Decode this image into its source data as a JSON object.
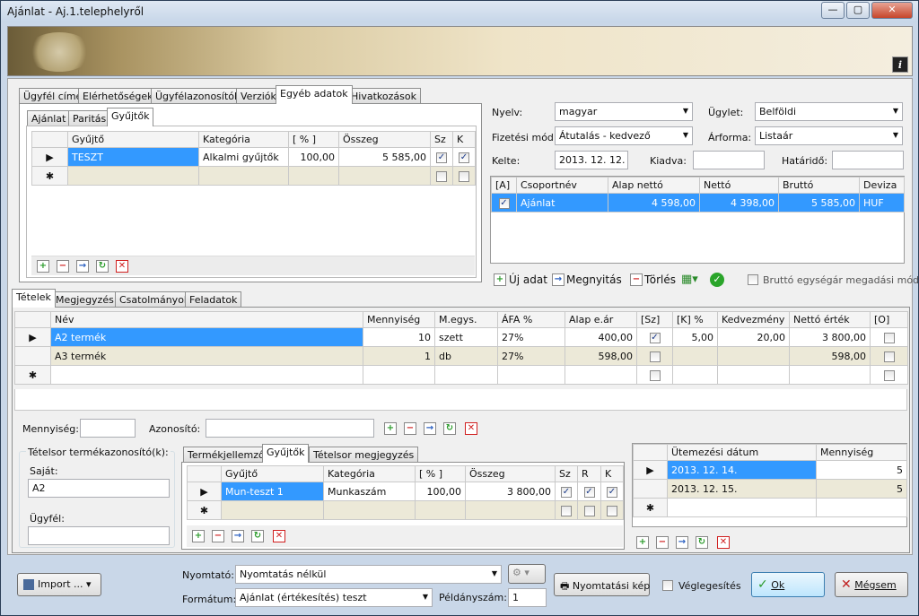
{
  "window": {
    "title": "Ajánlat - Aj.1.telephelyről",
    "min": "—",
    "max": "▢",
    "close": "✕"
  },
  "top_tabs": [
    "Ügyfél címe",
    "Elérhetőségek",
    "Ügyfélazonosítók",
    "Verziók",
    "Egyéb adatok",
    "Hivatkozások"
  ],
  "sub_tabs": [
    "Ajánlat",
    "Paritás",
    "Gyűjtők"
  ],
  "gy_grid": {
    "headers": [
      "Gyűjtő",
      "Kategória",
      "[ % ]",
      "Összeg",
      "Sz",
      "K"
    ],
    "rows": [
      {
        "gyujto": "TESZT",
        "kategoria": "Alkalmi gyűjtők",
        "pct": "100,00",
        "osszeg": "5 585,00"
      }
    ]
  },
  "form": {
    "nyelv_label": "Nyelv:",
    "nyelv": "magyar",
    "ugylet_label": "Ügylet:",
    "ugylet": "Belföldi",
    "fizmod_label": "Fizetési mód:",
    "fizmod": "Átutalás - kedvező",
    "arforma_label": "Árforma:",
    "arforma": "Listaár",
    "kelte_label": "Kelte:",
    "kelte": "2013. 12. 12.",
    "kiadva_label": "Kiadva:",
    "hatarido_label": "Határidő:"
  },
  "group_grid": {
    "headers": [
      "[A]",
      "Csoportnév",
      "Alap nettó",
      "Nettó",
      "Bruttó",
      "Deviza"
    ],
    "rows": [
      {
        "nev": "Ajánlat",
        "alap": "4 598,00",
        "netto": "4 398,00",
        "brutto": "5 585,00",
        "deviza": "HUF"
      }
    ]
  },
  "actions": {
    "uj": "Új adat",
    "megnyitas": "Megnyitás",
    "torles": "Törlés",
    "brutto_mod": "Bruttó egységár megadási mód"
  },
  "item_tabs": [
    "Tételek",
    "Megjegyzés",
    "Csatolmányok",
    "Feladatok"
  ],
  "items": {
    "headers": [
      "Név",
      "Mennyiség",
      "M.egys.",
      "ÁFA %",
      "Alap e.ár",
      "[Sz]",
      "[K] %",
      "Kedvezmény",
      "Nettó érték",
      "[O]"
    ],
    "rows": [
      {
        "nev": "A2 termék",
        "menny": "10",
        "megys": "szett",
        "afa": "27%",
        "alap": "400,00",
        "k": "5,00",
        "kedv": "20,00",
        "netto": "3 800,00"
      },
      {
        "nev": "A3 termék",
        "menny": "1",
        "megys": "db",
        "afa": "27%",
        "alap": "598,00",
        "k": "",
        "kedv": "",
        "netto": "598,00"
      }
    ]
  },
  "filter": {
    "menny_label": "Mennyiség:",
    "azon_label": "Azonosító:"
  },
  "tetelsor": {
    "title": "Tételsor termékazonosító(k):",
    "sajat_label": "Saját:",
    "sajat": "A2",
    "ugyfel_label": "Ügyfél:"
  },
  "lower_tabs": [
    "Termékjellemzők",
    "Gyűjtők",
    "Tételsor megjegyzés"
  ],
  "lower_grid": {
    "headers": [
      "Gyűjtő",
      "Kategória",
      "[ % ]",
      "Összeg",
      "Sz",
      "R",
      "K"
    ],
    "rows": [
      {
        "gyujto": "Mun-teszt 1",
        "kategoria": "Munkaszám",
        "pct": "100,00",
        "osszeg": "3 800,00"
      }
    ]
  },
  "schedule": {
    "headers": [
      "Ütemezési dátum",
      "Mennyiség"
    ],
    "rows": [
      {
        "datum": "2013. 12. 14.",
        "menny": "5"
      },
      {
        "datum": "2013. 12. 15.",
        "menny": "5"
      }
    ]
  },
  "footer": {
    "import": "Import ...",
    "nyomtato_label": "Nyomtató:",
    "nyomtato": "Nyomtatás nélkül",
    "formatum_label": "Formátum:",
    "formatum": "Ajánlat (értékesítés) teszt",
    "peldany_label": "Példányszám:",
    "peldany": "1",
    "nyomtatasi_kep": "Nyomtatási kép",
    "veglegesites": "Véglegesítés",
    "ok": "Ok",
    "megsem": "Mégsem"
  }
}
